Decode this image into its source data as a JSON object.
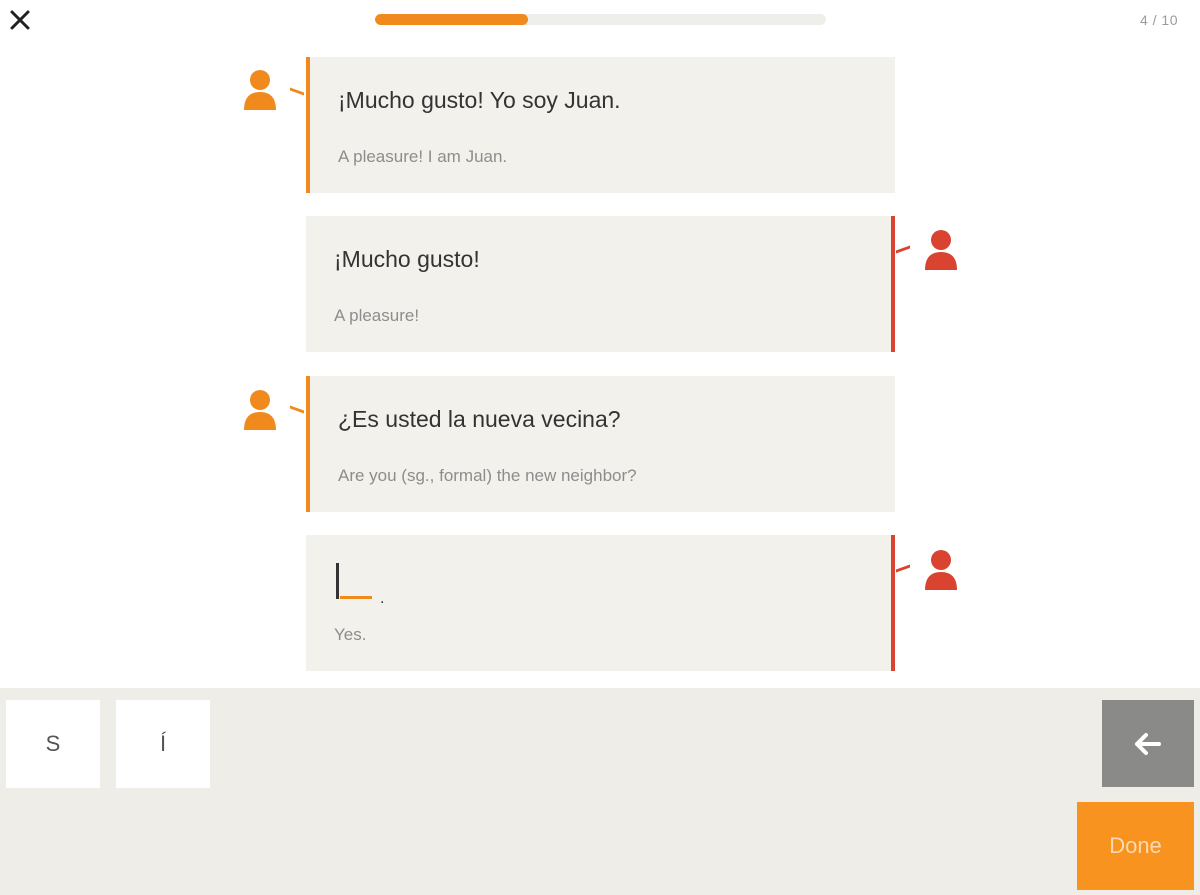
{
  "header": {
    "progress": 0.34,
    "counter": "4 / 10"
  },
  "colors": {
    "accent_orange": "#f18a1d",
    "accent_red": "#d9432f",
    "bubble_bg": "#f2f1ec",
    "panel_bg": "#eeede8",
    "done_bg": "#f7931e"
  },
  "dialogue": [
    {
      "speaker": "left",
      "spanish": "¡Mucho gusto! Yo soy Juan.",
      "english": "A pleasure! I am Juan."
    },
    {
      "speaker": "right",
      "spanish": "¡Mucho gusto!",
      "english": "A pleasure!"
    },
    {
      "speaker": "left",
      "spanish": "¿Es usted la nueva vecina?",
      "english": "Are you (sg., formal) the new neighbor?"
    },
    {
      "speaker": "right",
      "spanish": "",
      "english": "Yes.",
      "answer_suffix": "."
    }
  ],
  "keyboard": {
    "letters": [
      "S",
      "Í"
    ],
    "back_icon": "arrow-left-icon",
    "done_label": "Done"
  }
}
